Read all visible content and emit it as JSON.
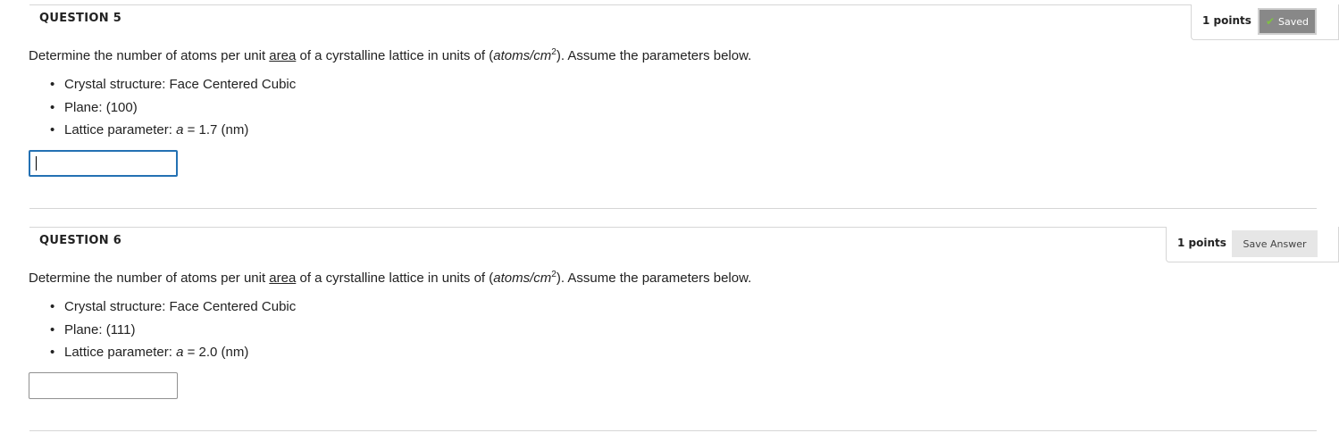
{
  "questions": [
    {
      "title": "QUESTION 5",
      "points": "1 points",
      "status_button": {
        "label": "Saved",
        "icon": "check-icon",
        "state": "saved"
      },
      "prompt": {
        "pre": "Determine the number of atoms per unit ",
        "underlined": "area",
        "mid": " of a cyrstalline lattice in units of (",
        "unit": "atoms/cm",
        "exp": "2",
        "post": "). Assume the parameters below."
      },
      "params": {
        "structure": "Crystal structure: Face Centered Cubic",
        "plane": "Plane: (100)",
        "lattice_prefix": "Lattice parameter: ",
        "lattice_var": "a",
        "lattice_value": " = 1.7 (nm)"
      },
      "answer": {
        "value": "",
        "focused": true
      }
    },
    {
      "title": "QUESTION 6",
      "points": "1 points",
      "status_button": {
        "label": "Save Answer",
        "state": "unsaved"
      },
      "prompt": {
        "pre": "Determine the number of atoms per unit ",
        "underlined": "area",
        "mid": " of a cyrstalline lattice in units of (",
        "unit": "atoms/cm",
        "exp": "2",
        "post": "). Assume the parameters below."
      },
      "params": {
        "structure": "Crystal structure: Face Centered Cubic",
        "plane": "Plane: (111)",
        "lattice_prefix": "Lattice parameter: ",
        "lattice_var": "a",
        "lattice_value": " = 2.0 (nm)"
      },
      "answer": {
        "value": "",
        "focused": false
      }
    }
  ],
  "colors": {
    "saved_button_bg": "#888888",
    "save_button_bg": "#e6e6e6",
    "focus_border": "#2471b3",
    "check": "#7ec242"
  }
}
